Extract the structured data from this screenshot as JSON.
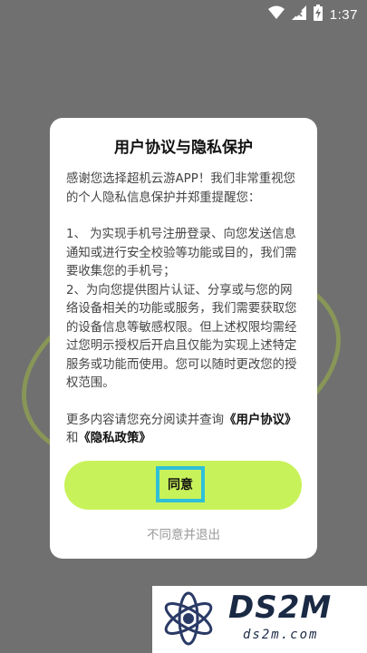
{
  "status_bar": {
    "time": "1:37",
    "icons": [
      "wifi-icon",
      "signal-icon",
      "battery-charging-icon"
    ]
  },
  "dialog": {
    "title": "用户协议与隐私保护",
    "intro": "感谢您选择超机云游APP！我们非常重视您的个人隐私信息保护并郑重提醒您：",
    "item1": "1、 为实现手机号注册登录、向您发送信息通知或进行安全校验等功能或目的，我们需要收集您的手机号；",
    "item2": "2、为向您提供图片认证、分享或与您的网络设备相关的功能或服务，我们需要获取您的设备信息等敏感权限。但上述权限均需经过您明示授权后开启且仅能为实现上述特定服务或功能而使用。您可以随时更改您的授权范围。",
    "more_prefix": "更多内容请您充分阅读并查询",
    "user_agreement_link": "《用户协议》",
    "and_text": "和",
    "privacy_policy_link": "《隐私政策》",
    "agree_label": "同意",
    "decline_label": "不同意并退出"
  },
  "watermark": {
    "title": "DS2M",
    "subtitle": "ds2m.com"
  },
  "colors": {
    "accent": "#c8f25a",
    "focus": "#2ec0d8",
    "overlay": "#707070"
  }
}
